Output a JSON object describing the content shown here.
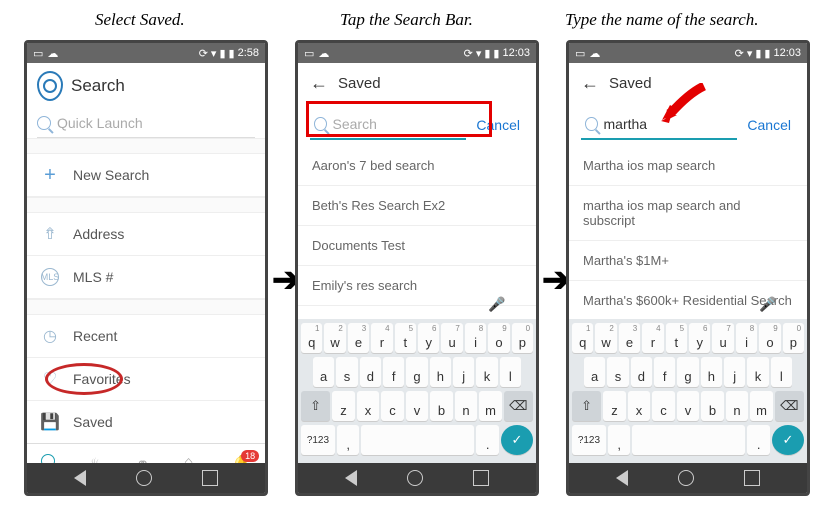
{
  "captions": {
    "c1": "Select Saved.",
    "c2": "Tap the Search Bar.",
    "c3": "Type the name of the search."
  },
  "phone1": {
    "time": "2:58",
    "title": "Search",
    "quick_launch_ph": "Quick Launch",
    "items": {
      "new_search": "New Search",
      "address": "Address",
      "mls": "MLS #",
      "recent": "Recent",
      "favorites": "Favorites",
      "saved": "Saved"
    },
    "badge": "18"
  },
  "phone2": {
    "time": "12:03",
    "title": "Saved",
    "search_ph": "Search",
    "search_val": "",
    "cancel": "Cancel",
    "results": [
      "Aaron's 7 bed search",
      "Beth's Res Search Ex2",
      "Documents Test",
      "Emily's res search"
    ],
    "suggest": [
      "",
      "",
      ""
    ]
  },
  "phone3": {
    "time": "12:03",
    "title": "Saved",
    "search_ph": "Search",
    "search_val": "martha",
    "cancel": "Cancel",
    "results": [
      "Martha ios map search",
      "martha ios map search and subscript",
      "Martha's $1M+",
      "Martha's $600k+ Residential Search"
    ]
  },
  "keyboard": {
    "row1": [
      [
        "q",
        "1"
      ],
      [
        "w",
        "2"
      ],
      [
        "e",
        "3"
      ],
      [
        "r",
        "4"
      ],
      [
        "t",
        "5"
      ],
      [
        "y",
        "6"
      ],
      [
        "u",
        "7"
      ],
      [
        "i",
        "8"
      ],
      [
        "o",
        "9"
      ],
      [
        "p",
        "0"
      ]
    ],
    "row2": [
      "a",
      "s",
      "d",
      "f",
      "g",
      "h",
      "j",
      "k",
      "l"
    ],
    "row3": [
      "z",
      "x",
      "c",
      "v",
      "b",
      "n",
      "m"
    ],
    "sym": "?123",
    "comma": ",",
    "period": "."
  }
}
